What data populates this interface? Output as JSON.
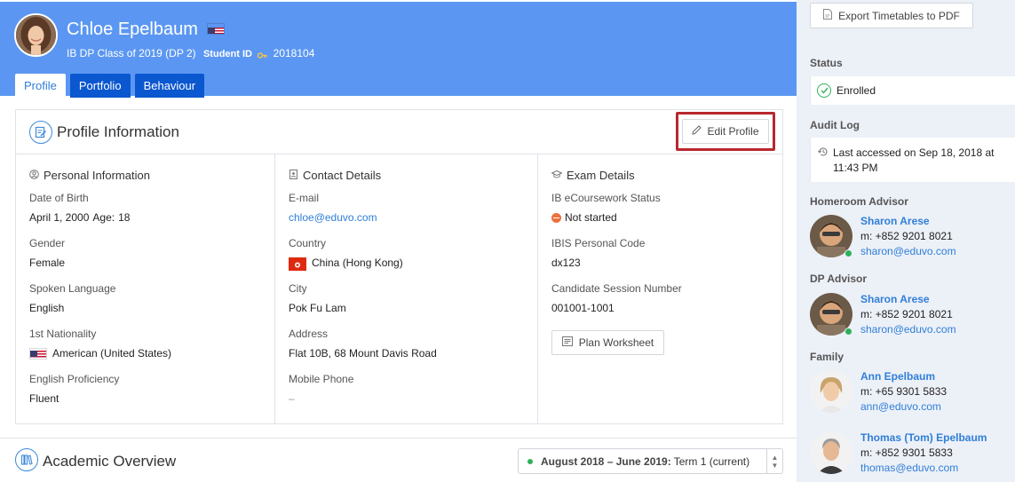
{
  "student": {
    "name": "Chloe Epelbaum",
    "class": "IB DP Class of 2019 (DP 2)",
    "student_id_label": "Student ID",
    "student_id": "2018104"
  },
  "tabs": [
    {
      "label": "Profile",
      "active": true
    },
    {
      "label": "Portfolio",
      "active": false
    },
    {
      "label": "Behaviour",
      "active": false
    }
  ],
  "profile": {
    "title": "Profile Information",
    "edit_label": "Edit Profile",
    "personal": {
      "title": "Personal Information",
      "dob_label": "Date of Birth",
      "dob": "April 1, 2000",
      "age_label": "Age:",
      "age": "18",
      "gender_label": "Gender",
      "gender": "Female",
      "language_label": "Spoken Language",
      "language": "English",
      "nationality_label": "1st Nationality",
      "nationality": "American (United States)",
      "proficiency_label": "English Proficiency",
      "proficiency": "Fluent"
    },
    "contact": {
      "title": "Contact Details",
      "email_label": "E-mail",
      "email": "chloe@eduvo.com",
      "country_label": "Country",
      "country": "China (Hong Kong)",
      "city_label": "City",
      "city": "Pok Fu Lam",
      "address_label": "Address",
      "address": "Flat 10B, 68 Mount Davis Road",
      "mobile_label": "Mobile Phone",
      "mobile": "–"
    },
    "exam": {
      "title": "Exam Details",
      "ecoursework_label": "IB eCoursework Status",
      "ecoursework": "Not started",
      "ibis_label": "IBIS Personal Code",
      "ibis": "dx123",
      "session_label": "Candidate Session Number",
      "session": "001001-1001",
      "plan_label": "Plan Worksheet"
    }
  },
  "academic": {
    "title": "Academic Overview",
    "term_bold": "August 2018 – June 2019:",
    "term_rest": "Term 1 (current)"
  },
  "sidebar": {
    "export_label": "Export Timetables to PDF",
    "status_head": "Status",
    "status": "Enrolled",
    "audit_head": "Audit Log",
    "audit": "Last accessed on Sep 18, 2018 at 11:43 PM",
    "homeroom_head": "Homeroom Advisor",
    "homeroom": {
      "name": "Sharon Arese",
      "phone": "m: +852 9201 8021",
      "email": "sharon@eduvo.com"
    },
    "dp_head": "DP Advisor",
    "dp": {
      "name": "Sharon Arese",
      "phone": "m: +852 9201 8021",
      "email": "sharon@eduvo.com"
    },
    "family_head": "Family",
    "family": [
      {
        "name": "Ann Epelbaum",
        "phone": "m: +65 9301 5833",
        "email": "ann@eduvo.com"
      },
      {
        "name": "Thomas (Tom) Epelbaum",
        "phone": "m: +852 9301 5833",
        "email": "thomas@eduvo.com"
      }
    ]
  },
  "colors": {
    "header_bg": "#5b97f2",
    "tab_bg": "#0b57d0",
    "link": "#2f7fd8",
    "highlight": "#b8282e",
    "enrolled": "#2fb15a",
    "not_started": "#f0703c"
  }
}
